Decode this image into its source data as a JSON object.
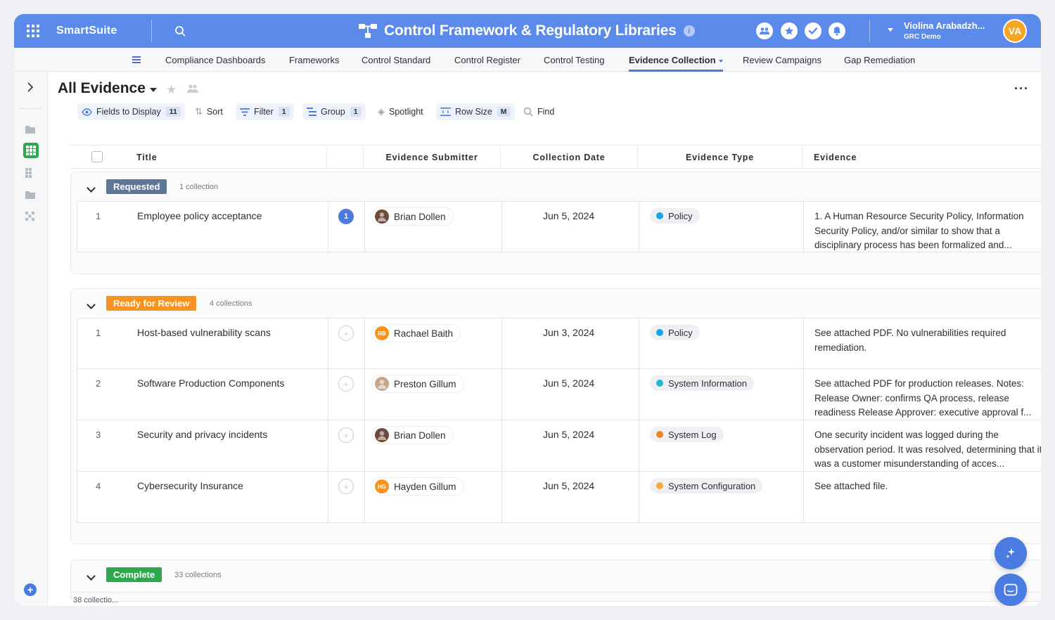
{
  "app": {
    "brand": "SmartSuite",
    "title": "Control Framework & Regulatory Libraries",
    "user_name": "Violina Arabadzh...",
    "user_org": "GRC Demo",
    "user_initials": "VA"
  },
  "nav": {
    "tabs": [
      {
        "label": "Compliance Dashboards"
      },
      {
        "label": "Frameworks"
      },
      {
        "label": "Control Standard"
      },
      {
        "label": "Control Register"
      },
      {
        "label": "Control Testing"
      },
      {
        "label": "Evidence Collection",
        "active": true
      },
      {
        "label": "Review Campaigns"
      },
      {
        "label": "Gap Remediation"
      }
    ]
  },
  "view": {
    "title": "All Evidence",
    "toolbar": {
      "fields": "Fields to Display",
      "fields_count": "11",
      "sort": "Sort",
      "filter": "Filter",
      "filter_count": "1",
      "group": "Group",
      "group_count": "1",
      "spotlight": "Spotlight",
      "rowsize": "Row Size",
      "rowsize_value": "M",
      "find": "Find"
    }
  },
  "table": {
    "columns": [
      "Title",
      "",
      "Evidence Submitter",
      "Collection Date",
      "Evidence Type",
      "Evidence"
    ]
  },
  "groups": [
    {
      "label": "Requested",
      "count": "1 collection",
      "color": "#5f7796",
      "rows": [
        {
          "num": "1",
          "title": "Employee policy acceptance",
          "comments": "1",
          "submitter": "Brian Dollen",
          "initials": "",
          "avatar_color": "#6b4a3a",
          "date": "Jun 5, 2024",
          "type": "Policy",
          "type_color": "#1aa3e8",
          "evidence": "1. A Human Resource Security Policy, Information Security Policy, and/or similar to show that a disciplinary process has been formalized and..."
        }
      ]
    },
    {
      "label": "Ready for Review",
      "count": "4 collections",
      "color": "#f7931e",
      "rows": [
        {
          "num": "1",
          "title": "Host-based vulnerability scans",
          "comments": "",
          "submitter": "Rachael Baith",
          "initials": "RB",
          "avatar_color": "#f7931e",
          "date": "Jun 3, 2024",
          "type": "Policy",
          "type_color": "#1aa3e8",
          "evidence": "See attached PDF. No vulnerabilities required remediation."
        },
        {
          "num": "2",
          "title": "Software Production Components",
          "comments": "",
          "submitter": "Preston Gillum",
          "initials": "",
          "avatar_color": "#c9a58a",
          "date": "Jun 5, 2024",
          "type": "System Information",
          "type_color": "#1fb8c9",
          "evidence": "See attached PDF for production releases. Notes: Release Owner: confirms QA process, release readiness Release Approver: executive approval f..."
        },
        {
          "num": "3",
          "title": "Security and privacy incidents",
          "comments": "",
          "submitter": "Brian Dollen",
          "initials": "",
          "avatar_color": "#6b4a3a",
          "date": "Jun 5, 2024",
          "type": "System Log",
          "type_color": "#f5811f",
          "evidence": "One security incident was logged during the observation period. It was resolved, determining that it was a customer misunderstanding of acces..."
        },
        {
          "num": "4",
          "title": "Cybersecurity Insurance",
          "comments": "",
          "submitter": "Hayden Gillum",
          "initials": "HG",
          "avatar_color": "#f7931e",
          "date": "Jun 5, 2024",
          "type": "System Configuration",
          "type_color": "#f9a93a",
          "evidence": "See attached file."
        }
      ]
    },
    {
      "label": "Complete",
      "count": "33 collections",
      "color": "#2ea84f",
      "rows": []
    }
  ],
  "footer": {
    "count": "38 collectio..."
  },
  "icons": [
    "apps-grid-icon",
    "search-icon",
    "info-icon",
    "team-icon",
    "star-badge-icon",
    "check-icon",
    "bell-icon",
    "chevron-right-icon",
    "folder-icon",
    "grid-view-icon",
    "ai-sparkle-icon",
    "chat-icon"
  ]
}
